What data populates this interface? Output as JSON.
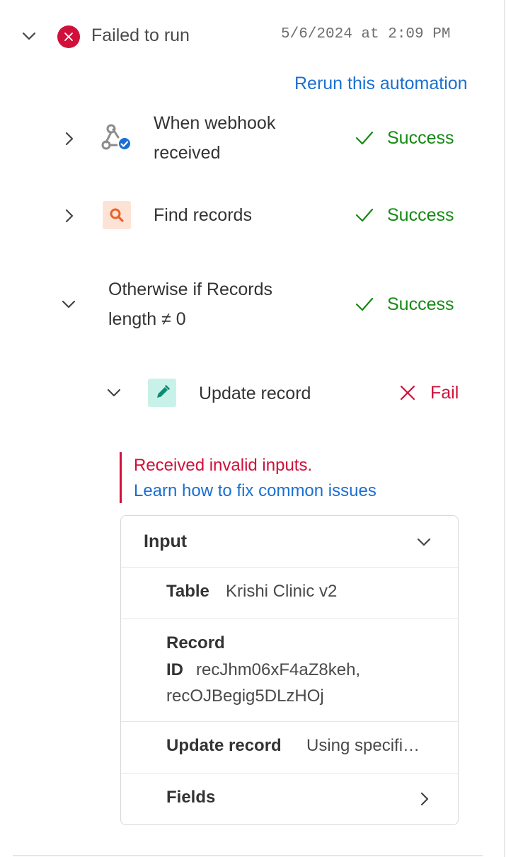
{
  "run": {
    "status_label": "Failed to run",
    "timestamp": "5/6/2024 at 2:09 PM",
    "rerun_link": "Rerun this automation"
  },
  "steps": [
    {
      "title_line1": "When webhook",
      "title_line2": "received",
      "status": "Success",
      "icon": "webhook-icon"
    },
    {
      "title": "Find records",
      "status": "Success",
      "icon": "search-icon"
    },
    {
      "title_line1": "Otherwise if Records",
      "title_line2": "length ≠ 0",
      "status": "Success"
    },
    {
      "title": "Update record",
      "status": "Fail",
      "icon": "pencil-icon"
    }
  ],
  "error": {
    "message": "Received invalid inputs.",
    "help_link": "Learn how to fix common issues"
  },
  "input_panel": {
    "header": "Input",
    "fields": {
      "table": {
        "label": "Table",
        "value": "Krishi Clinic v2"
      },
      "record_id": {
        "label_line1": "Record",
        "label_line2": "ID",
        "value_line1": "recJhm06xF4aZ8keh,",
        "value_line2": "recOJBegig5DLzHOj"
      },
      "update_record": {
        "label": "Update record",
        "value": "Using specifi…"
      },
      "fields": {
        "label": "Fields"
      }
    }
  },
  "colors": {
    "success": "#158a15",
    "fail": "#d0103a",
    "link": "#1a6fd1",
    "webhook_badge": "#1a6fd1",
    "search_bg": "#fde3d6",
    "search_fg": "#e8622a",
    "pencil_bg": "#c8f2e9",
    "pencil_fg": "#0f8a73"
  }
}
